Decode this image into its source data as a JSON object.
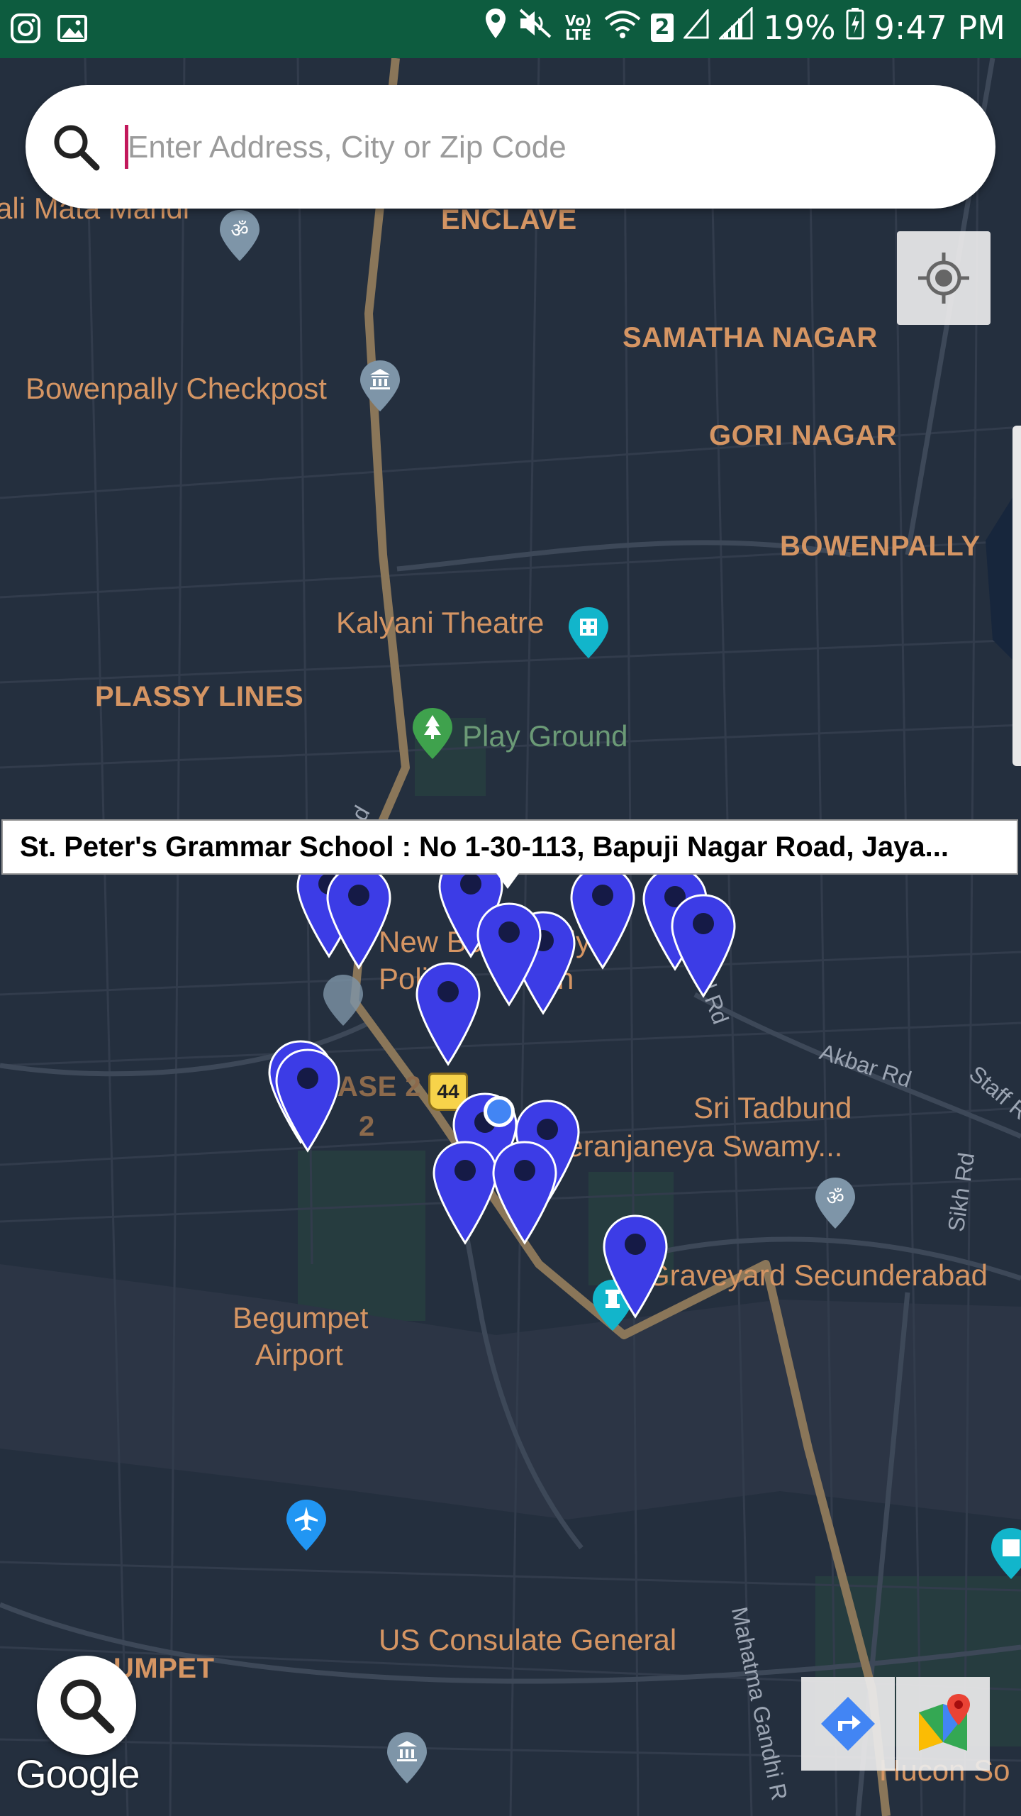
{
  "status_bar": {
    "battery": "19%",
    "time": "9:47 PM",
    "sim_badge": "2",
    "network": "Vo) LTE"
  },
  "search": {
    "placeholder": "Enter Address, City or Zip Code"
  },
  "map": {
    "neighborhoods": [
      "ENCLAVE",
      "SAMATHA NAGAR",
      "GORI NAGAR",
      "BOWENPALLY",
      "PLASSY LINES",
      "ASE 2",
      "2",
      "UMPET"
    ],
    "places": [
      "ali Mata Mandi",
      "Bowenpally Checkpost",
      "Kalyani Theatre",
      "New Bo",
      "ally",
      "Poli",
      "S",
      "n",
      "Sri Tadbund",
      "eeranjaneya Swamy...",
      "Graveyard Secunderabad",
      "Begumpet",
      "Airport",
      "US Consulate General",
      "Hucon So"
    ],
    "parks": [
      "Play Ground"
    ],
    "roads": [
      "Akbar Rd",
      "Staff R",
      "Sikh Rd",
      "Mahatma Gandhi R",
      "d Rd",
      "d"
    ],
    "highway_shield": "44",
    "tooltip": "St. Peter's Grammar School : No 1-30-113, Bapuji Nagar Road, Jaya...",
    "attribution": "Google",
    "marker_color": "#3c3ce6",
    "label_color": "#d59563"
  }
}
